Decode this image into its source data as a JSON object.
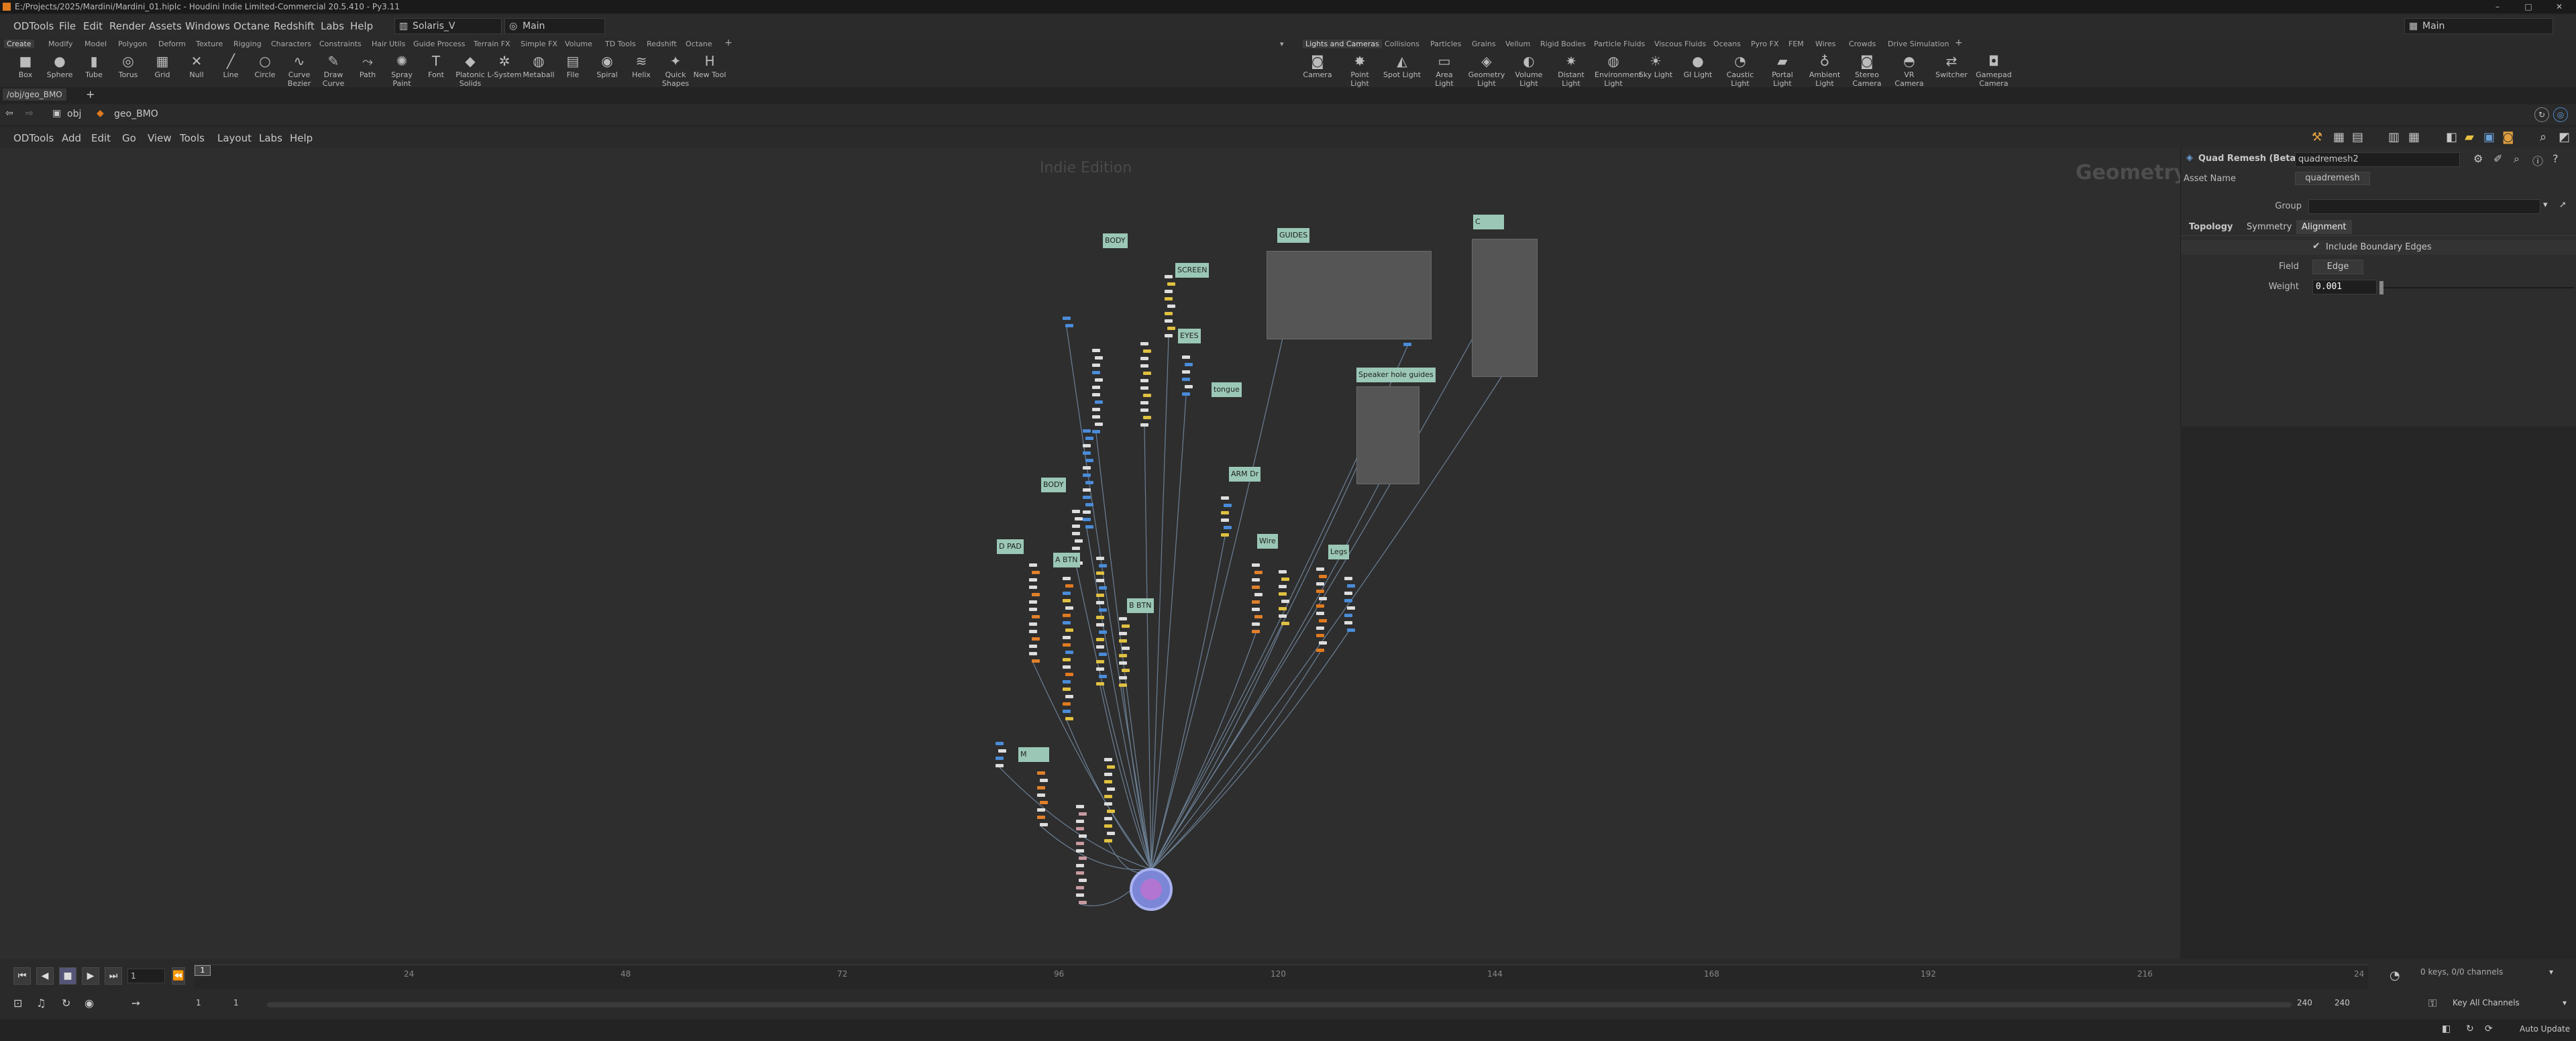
{
  "title_bar": {
    "title": "E:/Projects/2025/Mardini/Mardini_01.hiplc - Houdini Indie Limited-Commercial 20.5.410 - Py3.11",
    "min": "–",
    "max": "□",
    "close": "✕"
  },
  "menu": {
    "items": [
      "ODTools",
      "File",
      "Edit",
      "Render",
      "Assets",
      "Windows",
      "Octane",
      "Redshift",
      "Labs",
      "Help"
    ],
    "desktop": "Solaris_V",
    "context": "Main",
    "right_desktop": "Main"
  },
  "shelf_tabs_left": [
    "Create",
    "Modify",
    "Model",
    "Polygon",
    "Deform",
    "Texture",
    "Rigging",
    "Characters",
    "Constraints",
    "Hair Utils",
    "Guide Process",
    "Terrain FX",
    "Simple FX",
    "Volume",
    "TD Tools",
    "Redshift",
    "Octane"
  ],
  "shelf_tabs_right": [
    "Lights and Cameras",
    "Collisions",
    "Particles",
    "Grains",
    "Vellum",
    "Rigid Bodies",
    "Particle Fluids",
    "Viscous Fluids",
    "Oceans",
    "Pyro FX",
    "FEM",
    "Wires",
    "Crowds",
    "Drive Simulation"
  ],
  "tools_left": [
    {
      "label": "Box",
      "icon": "box-icon",
      "glyph": "■"
    },
    {
      "label": "Sphere",
      "icon": "sphere-icon",
      "glyph": "●"
    },
    {
      "label": "Tube",
      "icon": "tube-icon",
      "glyph": "▮"
    },
    {
      "label": "Torus",
      "icon": "torus-icon",
      "glyph": "◎"
    },
    {
      "label": "Grid",
      "icon": "grid-icon",
      "glyph": "▦"
    },
    {
      "label": "Null",
      "icon": "null-icon",
      "glyph": "✕"
    },
    {
      "label": "Line",
      "icon": "line-icon",
      "glyph": "╱"
    },
    {
      "label": "Circle",
      "icon": "circle-icon",
      "glyph": "○"
    },
    {
      "label": "Curve Bezier",
      "icon": "curve-bezier-icon",
      "glyph": "∿"
    },
    {
      "label": "Draw Curve",
      "icon": "draw-curve-icon",
      "glyph": "✎"
    },
    {
      "label": "Path",
      "icon": "path-icon",
      "glyph": "⤳"
    },
    {
      "label": "Spray Paint",
      "icon": "spray-paint-icon",
      "glyph": "✺"
    },
    {
      "label": "Font",
      "icon": "font-icon",
      "glyph": "T"
    },
    {
      "label": "Platonic Solids",
      "icon": "platonic-icon",
      "glyph": "◆"
    },
    {
      "label": "L-System",
      "icon": "lsystem-icon",
      "glyph": "✲"
    },
    {
      "label": "Metaball",
      "icon": "metaball-icon",
      "glyph": "◍"
    },
    {
      "label": "File",
      "icon": "file-icon",
      "glyph": "▤"
    },
    {
      "label": "Spiral",
      "icon": "spiral-icon",
      "glyph": "◉"
    },
    {
      "label": "Helix",
      "icon": "helix-icon",
      "glyph": "≋"
    },
    {
      "label": "Quick Shapes",
      "icon": "quick-shapes-icon",
      "glyph": "✦"
    },
    {
      "label": "New Tool",
      "icon": "new-tool-icon",
      "glyph": "H"
    }
  ],
  "tools_right": [
    {
      "label": "Camera",
      "icon": "camera-icon",
      "glyph": "◙"
    },
    {
      "label": "Point Light",
      "icon": "point-light-icon",
      "glyph": "✸"
    },
    {
      "label": "Spot Light",
      "icon": "spot-light-icon",
      "glyph": "◭"
    },
    {
      "label": "Area Light",
      "icon": "area-light-icon",
      "glyph": "▭"
    },
    {
      "label": "Geometry Light",
      "icon": "geometry-light-icon",
      "glyph": "◈"
    },
    {
      "label": "Volume Light",
      "icon": "volume-light-icon",
      "glyph": "◐"
    },
    {
      "label": "Distant Light",
      "icon": "distant-light-icon",
      "glyph": "✷"
    },
    {
      "label": "Environment Light",
      "icon": "environment-light-icon",
      "glyph": "◍"
    },
    {
      "label": "Sky Light",
      "icon": "sky-light-icon",
      "glyph": "☀"
    },
    {
      "label": "GI Light",
      "icon": "gi-light-icon",
      "glyph": "●"
    },
    {
      "label": "Caustic Light",
      "icon": "caustic-light-icon",
      "glyph": "◔"
    },
    {
      "label": "Portal Light",
      "icon": "portal-light-icon",
      "glyph": "▰"
    },
    {
      "label": "Ambient Light",
      "icon": "ambient-light-icon",
      "glyph": "♁"
    },
    {
      "label": "Stereo Camera",
      "icon": "stereo-camera-icon",
      "glyph": "◙"
    },
    {
      "label": "VR Camera",
      "icon": "vr-camera-icon",
      "glyph": "◓"
    },
    {
      "label": "Switcher",
      "icon": "switcher-icon",
      "glyph": "⇄"
    },
    {
      "label": "Gamepad Camera",
      "icon": "gamepad-camera-icon",
      "glyph": "◘"
    }
  ],
  "path_tab": "/obj/geo_BMO",
  "nav": {
    "obj": "obj",
    "node": "geo_BMO"
  },
  "network_menu": [
    "ODTools",
    "Add",
    "Edit",
    "Go",
    "View",
    "Tools",
    "Layout",
    "Labs",
    "Help"
  ],
  "network": {
    "watermark": "Indie Edition",
    "context_label": "Geometry",
    "sticky_notes": [
      "BODY",
      "SCREEN",
      "EYES",
      "tongue",
      "BODY",
      "D PAD",
      "A BTN",
      "B BTN",
      "ARM Dr",
      "Wire",
      "Legs",
      "GUIDES",
      "Speaker hole guides",
      "C",
      "M"
    ]
  },
  "params": {
    "node_type": "Quad Remesh (Beta)",
    "node_name": "quadremesh2",
    "asset_name_label": "Asset Name",
    "asset_name_value": "quadremesh",
    "group_label": "Group",
    "tabs": [
      "Topology",
      "Symmetry",
      "Alignment"
    ],
    "include_boundary_label": "Include Boundary Edges",
    "field_label": "Field",
    "field_value": "Edge",
    "weight_label": "Weight",
    "weight_value": "0.001",
    "weight_fraction": 0.0
  },
  "timeline": {
    "ticks": [
      "24",
      "48",
      "72",
      "96",
      "120",
      "144",
      "168",
      "192",
      "216",
      "24"
    ],
    "current_frame": "1",
    "start_frame": "1",
    "start_frame2": "1",
    "end_frame": "240",
    "end_frame2": "240",
    "keys_label": "0 keys, 0/0 channels",
    "key_channels": "Key All Channels",
    "auto_update": "Auto Update",
    "frame_marker": "1"
  }
}
